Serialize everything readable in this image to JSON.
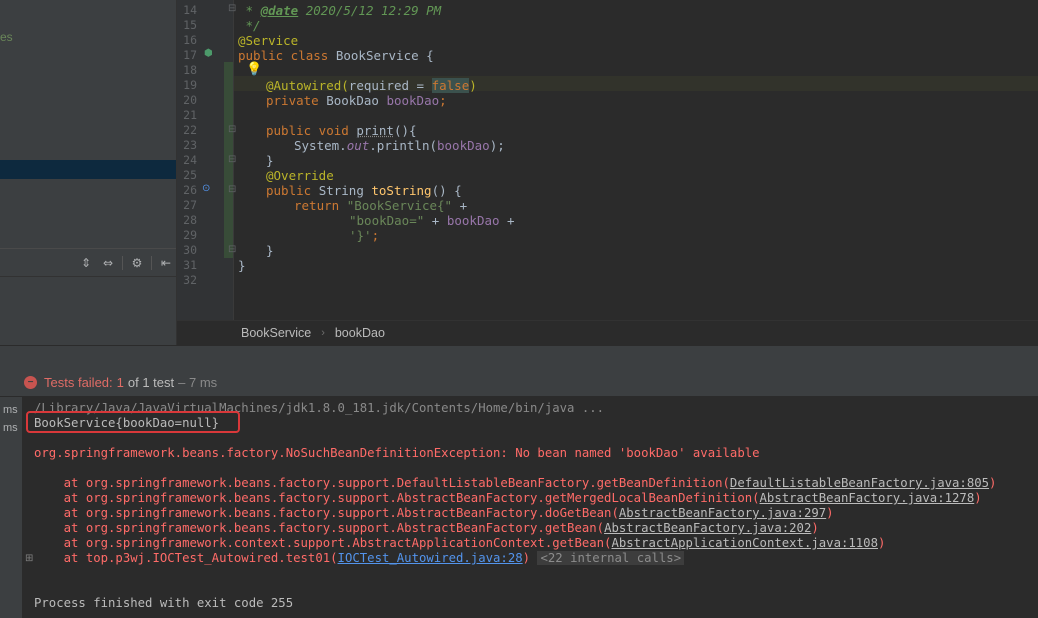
{
  "left_panel": {
    "partial_item": "es",
    "toolbar_icons": [
      "expand-all-icon",
      "collapse-all-icon",
      "settings-icon",
      "hide-icon"
    ]
  },
  "editor": {
    "line_numbers": [
      "14",
      "15",
      "16",
      "17",
      "18",
      "19",
      "20",
      "21",
      "22",
      "23",
      "24",
      "25",
      "26",
      "27",
      "28",
      "29",
      "30",
      "31",
      "32"
    ],
    "lines": {
      "l14_prefix": " * ",
      "l14_tag": "@date",
      "l14_text": " 2020/5/12 12:29 PM",
      "l15": " */",
      "l16": "@Service",
      "l17_kw": "public class ",
      "l17_name": "BookService {",
      "l19_ann": "@Autowired(",
      "l19_param": "required = ",
      "l19_false": "false",
      "l19_close": ")",
      "l20_kw": "private ",
      "l20_type": "BookDao ",
      "l20_field": "bookDao",
      "l20_semi": ";",
      "l22_kw": "public void ",
      "l22_name": "print",
      "l22_rest": "(){",
      "l23_sys": "System.",
      "l23_out": "out",
      "l23_call": ".println(",
      "l23_arg": "bookDao",
      "l23_end": ");",
      "l24": "}",
      "l25": "@Override",
      "l26_kw": "public ",
      "l26_type": "String ",
      "l26_name": "toString",
      "l26_rest": "() {",
      "l27_kw": "return ",
      "l27_str": "\"BookService{\"",
      "l27_plus": " +",
      "l28_str": "\"bookDao=\"",
      "l28_mid": " + ",
      "l28_field": "bookDao",
      "l28_plus": " +",
      "l29_str": "'}'",
      "l29_semi": ";",
      "l30": "}",
      "l31": "}"
    }
  },
  "breadcrumb": {
    "class_name": "BookService",
    "separator": "›",
    "field_name": "bookDao"
  },
  "run_panel": {
    "status_prefix": "Tests failed: ",
    "failed_count": "1",
    "of_text": " of 1 test",
    "duration": " – 7 ms",
    "tree_labels": [
      "ms",
      "ms"
    ],
    "console": {
      "java_cmd": "/Library/Java/JavaVirtualMachines/jdk1.8.0_181.jdk/Contents/Home/bin/java ...",
      "output": "BookService{bookDao=null}",
      "exception": "org.springframework.beans.factory.NoSuchBeanDefinitionException: No bean named 'bookDao' available",
      "stack": [
        {
          "at": "    at org.springframework.beans.factory.support.DefaultListableBeanFactory.getBeanDefinition(",
          "link": "DefaultListableBeanFactory.java:805",
          "end": ")"
        },
        {
          "at": "    at org.springframework.beans.factory.support.AbstractBeanFactory.getMergedLocalBeanDefinition(",
          "link": "AbstractBeanFactory.java:1278",
          "end": ")"
        },
        {
          "at": "    at org.springframework.beans.factory.support.AbstractBeanFactory.doGetBean(",
          "link": "AbstractBeanFactory.java:297",
          "end": ")"
        },
        {
          "at": "    at org.springframework.beans.factory.support.AbstractBeanFactory.getBean(",
          "link": "AbstractBeanFactory.java:202",
          "end": ")"
        },
        {
          "at": "    at org.springframework.context.support.AbstractApplicationContext.getBean(",
          "link": "AbstractApplicationContext.java:1108",
          "end": ")"
        }
      ],
      "last_at": "    at top.p3wj.IOCTest_Autowired.test01(",
      "last_link": "IOCTest_Autowired.java:28",
      "last_end": ") ",
      "internal_calls": "<22 internal calls>",
      "exit": "Process finished with exit code 255"
    }
  },
  "colors": {
    "error_red": "#ff6b68",
    "highlight_box": "#d9383a",
    "link_blue": "#5394ec"
  }
}
